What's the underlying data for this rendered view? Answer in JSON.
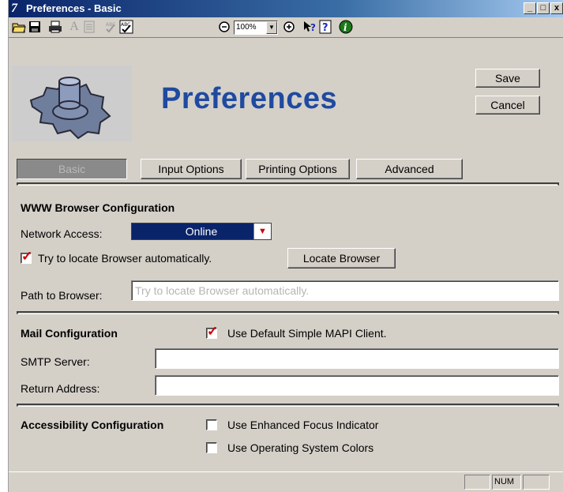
{
  "window": {
    "title": "Preferences - Basic",
    "minimize": "_",
    "maximize": "□",
    "close": "x"
  },
  "toolbar": {
    "zoom_value": "100%",
    "zoom_arrow": "▼",
    "icons": [
      "open-folder-icon",
      "save-disk-icon",
      "print-icon",
      "font-icon",
      "format-icon",
      "spellcheck-icon",
      "spellcheck-check-icon",
      "zoom-out-icon",
      "zoom-in-icon",
      "whats-this-help-icon",
      "help-icon",
      "info-icon"
    ]
  },
  "header": {
    "title": "Preferences",
    "save_label": "Save",
    "cancel_label": "Cancel",
    "logo_icon": "gear-database-icon"
  },
  "tabs": [
    {
      "label": "Basic",
      "active": true
    },
    {
      "label": "Input Options",
      "active": false
    },
    {
      "label": "Printing Options",
      "active": false
    },
    {
      "label": "Advanced",
      "active": false
    }
  ],
  "browser": {
    "section_title": "WWW Browser Configuration",
    "network_label": "Network Access:",
    "network_value": "Online",
    "auto_locate_label": "Try to locate Browser automatically.",
    "auto_locate_checked": true,
    "locate_button": "Locate Browser",
    "path_label": "Path to Browser:",
    "path_placeholder": "Try to locate Browser automatically."
  },
  "mail": {
    "section_title": "Mail Configuration",
    "mapi_label": "Use Default Simple MAPI Client.",
    "mapi_checked": true,
    "smtp_label": "SMTP Server:",
    "smtp_value": "",
    "return_label": "Return Address:",
    "return_value": ""
  },
  "accessibility": {
    "section_title": "Accessibility Configuration",
    "focus_label": "Use Enhanced Focus Indicator",
    "focus_checked": false,
    "os_colors_label": "Use Operating System Colors",
    "os_colors_checked": false
  },
  "status": {
    "num": "NUM"
  },
  "colors": {
    "title_blue": "#0a246a",
    "heading_blue": "#1f4aa0",
    "check_red": "#d40000",
    "face": "#d4d0c8"
  }
}
